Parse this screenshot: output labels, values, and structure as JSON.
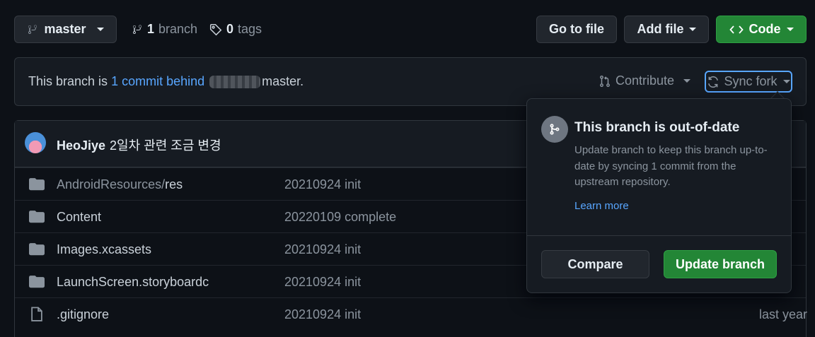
{
  "topbar": {
    "branch_label": "master",
    "branches_count": "1",
    "branches_label": "branch",
    "tags_count": "0",
    "tags_label": "tags",
    "goto_label": "Go to file",
    "addfile_label": "Add file",
    "code_label": "Code"
  },
  "sync": {
    "prefix": "This branch is ",
    "link": "1 commit behind",
    "suffix": "master.",
    "contribute_label": "Contribute",
    "syncfork_label": "Sync fork"
  },
  "commit": {
    "author": "HeoJiye",
    "message": "2일차 관련 조금 변경"
  },
  "files": [
    {
      "name_prefix": "AndroidResources/",
      "name": "res",
      "commit": "20210924 init",
      "age": "",
      "type": "folder"
    },
    {
      "name_prefix": "",
      "name": "Content",
      "commit": "20220109 complete",
      "age": "",
      "type": "folder"
    },
    {
      "name_prefix": "",
      "name": "Images.xcassets",
      "commit": "20210924 init",
      "age": "",
      "type": "folder"
    },
    {
      "name_prefix": "",
      "name": "LaunchScreen.storyboardc",
      "commit": "20210924 init",
      "age": "",
      "type": "folder"
    },
    {
      "name_prefix": "",
      "name": ".gitignore",
      "commit": "20210924 init",
      "age": "last year",
      "type": "file"
    }
  ],
  "popover": {
    "title": "This branch is out-of-date",
    "description": "Update branch to keep this branch up-to-date by syncing 1 commit from the upstream repository.",
    "learn_more": "Learn more",
    "compare_label": "Compare",
    "update_label": "Update branch"
  },
  "colors": {
    "background": "#0d1117",
    "primary_green": "#238636",
    "link_blue": "#58a6ff"
  }
}
